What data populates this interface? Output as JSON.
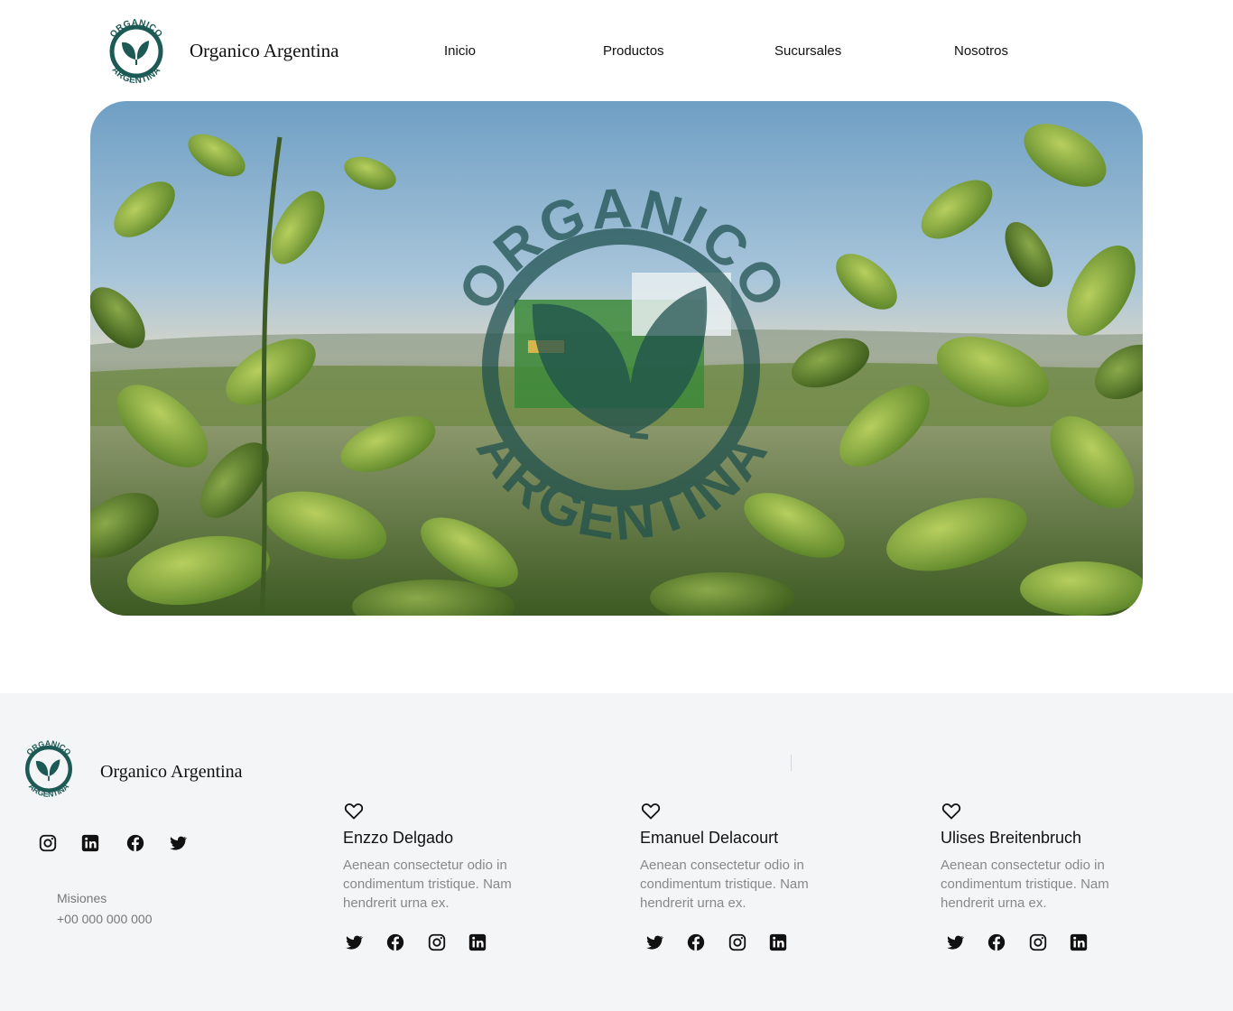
{
  "header": {
    "brand": "Organico Argentina",
    "logo_text_top": "ORGANICO",
    "logo_text_bottom": "ARGENTINA",
    "nav": [
      "Inicio",
      "Productos",
      "Sucursales",
      "Nosotros"
    ]
  },
  "hero": {
    "watermark_top": "ORGANICO",
    "watermark_bottom": "ARGENTINA"
  },
  "footer": {
    "brand": "Organico Argentina",
    "logo_text_top": "ORGANICO",
    "logo_text_bottom": "ARGENTINA",
    "social_icons": [
      "instagram-icon",
      "linkedin-icon",
      "facebook-icon",
      "twitter-icon"
    ],
    "city": "Misiones",
    "phone": "+00 000 000 000",
    "team": [
      {
        "name": "Enzzo Delgado",
        "description": "Aenean consectetur odio in condimentum tristique. Nam hendrerit urna ex."
      },
      {
        "name": "Emanuel Delacourt",
        "description": "Aenean consectetur odio in condimentum tristique. Nam hendrerit urna ex."
      },
      {
        "name": "Ulises Breitenbruch",
        "description": "Aenean consectetur odio in condimentum tristique. Nam hendrerit urna ex."
      }
    ],
    "card_icons": [
      "twitter-icon",
      "facebook-icon",
      "instagram-icon",
      "linkedin-icon"
    ]
  },
  "colors": {
    "brand_green": "#1d5a55",
    "footer_bg": "#f4f5f7"
  }
}
